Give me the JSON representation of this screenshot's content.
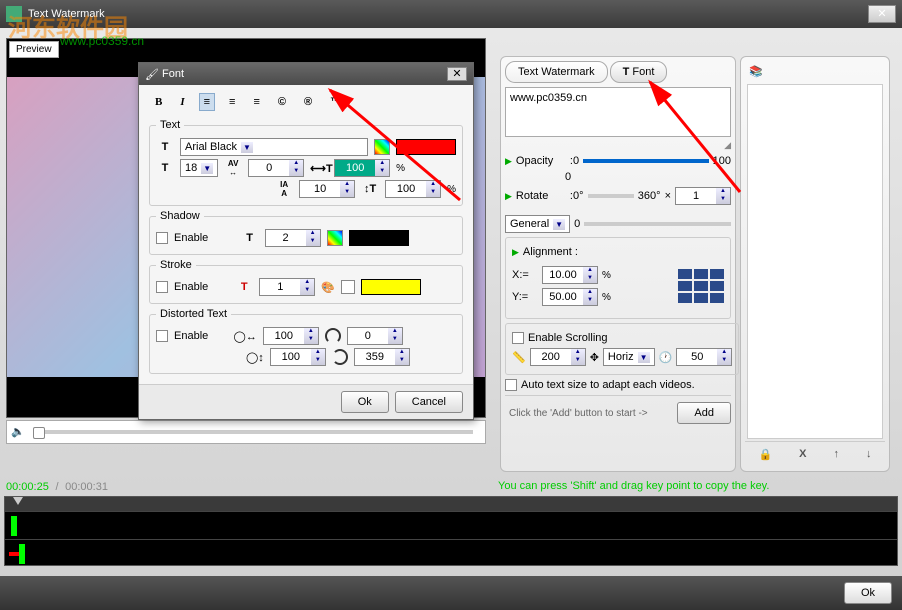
{
  "window": {
    "title": "Text Watermark"
  },
  "watermark": {
    "brand": "河东软件园",
    "url": "www.pc0359.cn"
  },
  "preview": {
    "label": "Preview"
  },
  "time": {
    "current": "00:00:25",
    "total": "00:00:31"
  },
  "tip": "You can press 'Shift' and drag key point to copy the key.",
  "tabs": {
    "text": "Text Watermark",
    "font": "Font",
    "font_prefix": "T"
  },
  "textarea": "www.pc0359.cn",
  "opacity": {
    "label": "Opacity",
    "min": ":0",
    "max": "100",
    "value": "0"
  },
  "rotate": {
    "label": "Rotate",
    "min": ":0°",
    "mid": "360°",
    "mult": "×",
    "value": "1"
  },
  "general": {
    "label": "General",
    "value": "0"
  },
  "alignment": {
    "label": "Alignment :",
    "x_label": "X:=",
    "x": "10.00",
    "y_label": "Y:=",
    "y": "50.00",
    "pct": "%"
  },
  "scroll": {
    "enable": "Enable Scrolling",
    "width": "200",
    "dir": "Horiz",
    "speed": "50"
  },
  "autosize": "Auto text size to adapt each videos.",
  "hint": "Click the 'Add' button to start ->",
  "add": "Add",
  "ok": "Ok",
  "cancel": "Cancel",
  "font_dialog": {
    "title": "Font",
    "text_legend": "Text",
    "font_family": "Arial Black",
    "font_size": "18",
    "letter_spacing": "0",
    "width_scale": "100",
    "line_height": "10",
    "height_scale": "100",
    "shadow_legend": "Shadow",
    "shadow_enable": "Enable",
    "shadow_size": "2",
    "stroke_legend": "Stroke",
    "stroke_enable": "Enable",
    "stroke_size": "1",
    "distort_legend": "Distorted Text",
    "distort_enable": "Enable",
    "distort_a": "100",
    "distort_b": "0",
    "distort_c": "100",
    "distort_d": "359"
  },
  "icons": {
    "lock": "🔒",
    "delete": "X",
    "up": "↑",
    "down": "↓",
    "layers": "📚"
  }
}
